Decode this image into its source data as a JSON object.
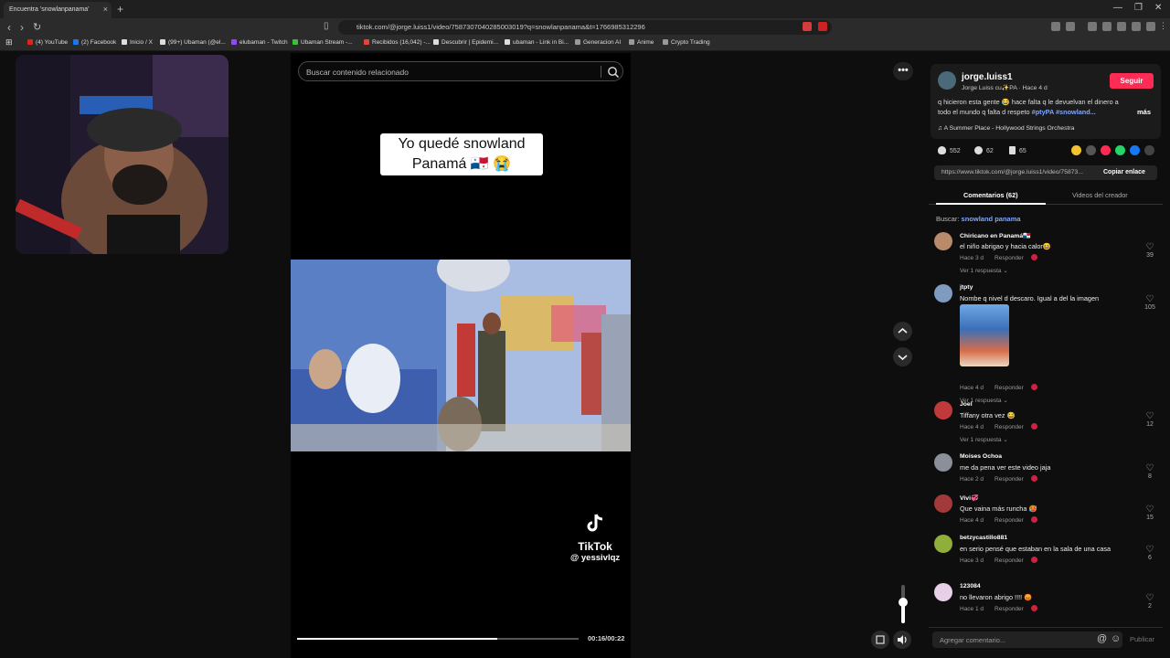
{
  "browser": {
    "tab_title": "Encuentra 'snowlanpanama'",
    "tab_close": "×",
    "new_tab": "+",
    "url": "tiktok.com/@jorge.luiss1/video/7587307040285003019?q=snowlanpanama&t=1766985312296",
    "bookmarks": [
      {
        "label": "(4) YouTube",
        "color": "#e62117"
      },
      {
        "label": "(2) Facebook",
        "color": "#1877f2"
      },
      {
        "label": "Inicio / X",
        "color": "#dddddd"
      },
      {
        "label": "(99+) Ubaman (@el...",
        "color": "#dddddd"
      },
      {
        "label": "elubaman - Twitch",
        "color": "#9146ff"
      },
      {
        "label": "Ubaman Stream -...",
        "color": "#3ac13a"
      },
      {
        "label": "Recibidos (16,042) -...",
        "color": "#ea4335"
      },
      {
        "label": "Descubrir | Epidemi...",
        "color": "#dddddd"
      },
      {
        "label": "ubaman - Link in Bi...",
        "color": "#dddddd"
      },
      {
        "label": "Generacion AI",
        "color": "#999999"
      },
      {
        "label": "Anime",
        "color": "#999999"
      },
      {
        "label": "Crypto Trading",
        "color": "#999999"
      }
    ]
  },
  "video": {
    "search_placeholder": "Buscar contenido relacionado",
    "caption_line1": "Yo quedé snowland",
    "caption_line2": "Panamá 🇵🇦 😭",
    "watermark_name": "TikTok",
    "watermark_user": "@ yessivlqz",
    "progress": 0.71,
    "time": "00:16/00:22",
    "volume": 0.55
  },
  "panel": {
    "author_name": "jorge.luiss1",
    "author_sub": "Jorge Luiss cu✨PA · Hace 4 d",
    "follow_label": "Seguir",
    "desc_text": "q hicieron esta gente 😂 hace falta q le devuelvan el dinero a todo el mundo q falta d respeto",
    "desc_tags": "#ptyPA #snowland...",
    "more_label": "más",
    "music": "♫  A Summer Place - Hollywood Strings Orchestra",
    "likes": "552",
    "comments_count": "62",
    "saves": "65",
    "link": "https://www.tiktok.com/@jorge.luiss1/video/75873...",
    "copy_label": "Copiar enlace",
    "tab_comments": "Comentarios (62)",
    "tab_creator": "Videos del creador",
    "search_prefix": "Buscar:",
    "search_query": "snowland panama",
    "add_placeholder": "Agregar comentario...",
    "publish_label": "Publicar"
  },
  "comments": [
    {
      "user": "Chiricano en Panamá🇵🇦",
      "text": "el niño abrigao y hacia calor😆",
      "time": "Hace 3 d",
      "reply": "Responder",
      "view": "Ver 1 respuesta ⌄",
      "likes": "39",
      "color": "#b98a6a"
    },
    {
      "user": "jtpty",
      "text": "Nombe q nivel d descaro. Igual a del la imagen",
      "time": "Hace 4 d",
      "reply": "Responder",
      "view": "Ver 1 respuesta ⌄",
      "likes": "105",
      "color": "#7f9cc0"
    },
    {
      "user": "Joel",
      "text": "Tiffany otra vez 😂",
      "time": "Hace 4 d",
      "reply": "Responder",
      "view": "Ver 1 respuesta ⌄",
      "likes": "12",
      "color": "#c0393b"
    },
    {
      "user": "Moises Ochoa",
      "text": "me da pena ver este video jaja",
      "time": "Hace 2 d",
      "reply": "Responder",
      "view": "",
      "likes": "8",
      "color": "#8a8f99"
    },
    {
      "user": "Vivi💞",
      "text": "Que vaina más runcha 🥵",
      "time": "Hace 4 d",
      "reply": "Responder",
      "view": "",
      "likes": "15",
      "color": "#a33a3a"
    },
    {
      "user": "betzycastillo881",
      "text": "en serio pensé que estaban en la sala de una casa",
      "time": "Hace 3 d",
      "reply": "Responder",
      "view": "",
      "likes": "6",
      "color": "#8fae3a"
    },
    {
      "user": "123084",
      "text": "no llevaron abrigo !!!! 😡",
      "time": "Hace 1 d",
      "reply": "Responder",
      "view": "",
      "likes": "2",
      "color": "#e8d0e8"
    }
  ],
  "colors": {
    "accent": "#fe2c55",
    "link": "#7ea6ff"
  }
}
